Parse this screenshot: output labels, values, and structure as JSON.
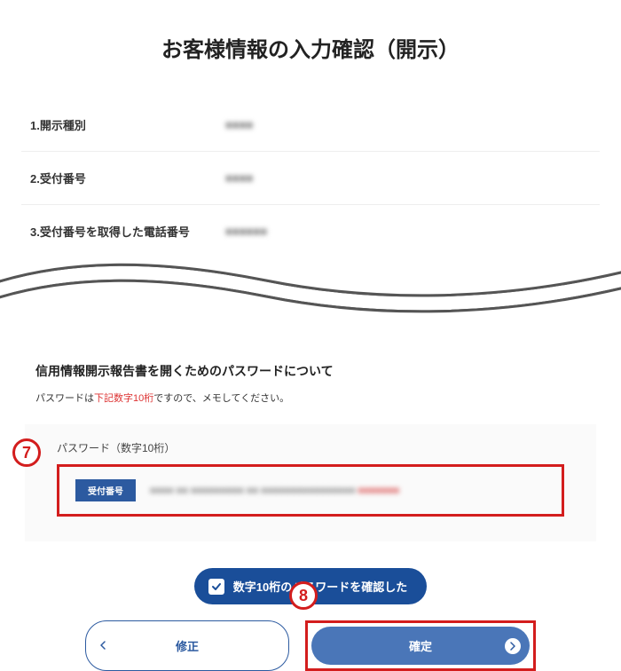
{
  "header": {
    "title": "お客様情報の入力確認（開示）"
  },
  "info_rows": [
    {
      "label": "1.開示種別",
      "value": "■■■■"
    },
    {
      "label": "2.受付番号",
      "value": "■■■■"
    },
    {
      "label": "3.受付番号を取得した電話番号",
      "value": "■■■■■■"
    }
  ],
  "password_section": {
    "title": "信用情報開示報告書を開くためのパスワードについて",
    "note_prefix": "パスワードは",
    "note_red": "下記数字10桁",
    "note_suffix": "ですので、メモしてください。",
    "sub_label": "パスワード（数字10桁）",
    "tag": "受付番号",
    "blurred": "■■■■  ■■ ■■■■■■■■■ ■■ ■■■■■■■■■■■■■■■■",
    "blurred_red": "■■■■■■■"
  },
  "confirm_button": "数字10桁のパスワードを確認した",
  "actions": {
    "back": "修正",
    "submit": "確定"
  },
  "callouts": {
    "seven": "7",
    "eight": "8"
  }
}
